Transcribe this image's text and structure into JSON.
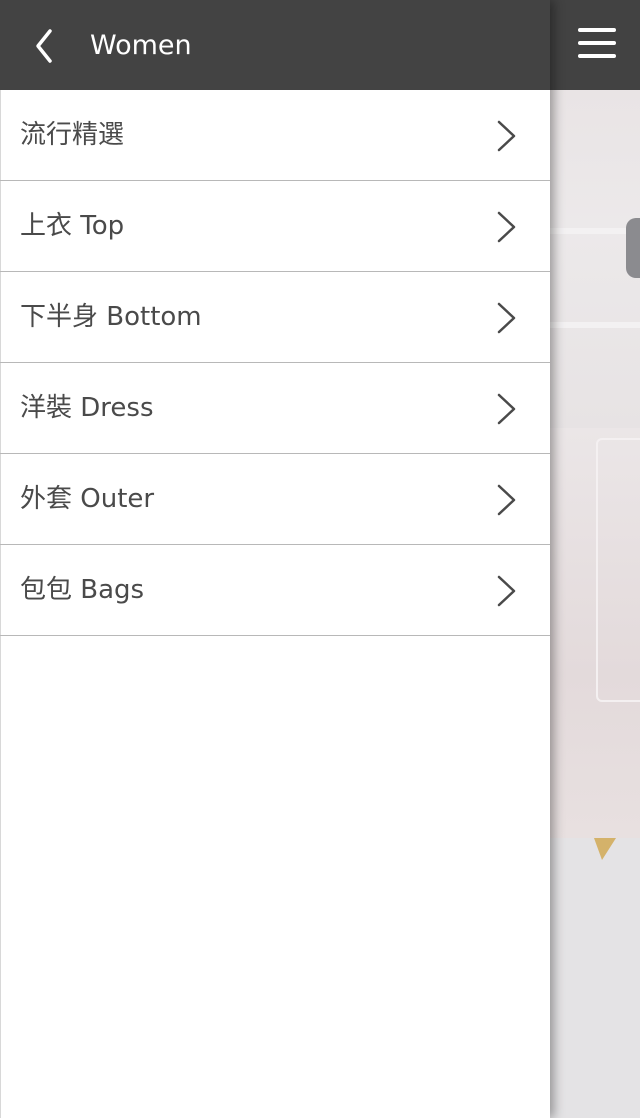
{
  "drawer": {
    "title": "Women",
    "back_icon": "chevron-left-icon",
    "items": [
      {
        "label": "流行精選",
        "icon": "chevron-right-icon"
      },
      {
        "label": "上衣 Top",
        "icon": "chevron-right-icon"
      },
      {
        "label": "下半身 Bottom",
        "icon": "chevron-right-icon"
      },
      {
        "label": "洋裝 Dress",
        "icon": "chevron-right-icon"
      },
      {
        "label": "外套 Outer",
        "icon": "chevron-right-icon"
      },
      {
        "label": "包包 Bags",
        "icon": "chevron-right-icon"
      }
    ]
  },
  "header": {
    "menu_icon": "hamburger-menu-icon"
  },
  "colors": {
    "header_bg": "#434343",
    "drawer_bg": "#ffffff",
    "text": "#4a4a4a",
    "divider": "#b8b8b8",
    "accent_gold": "#d4b26a"
  }
}
